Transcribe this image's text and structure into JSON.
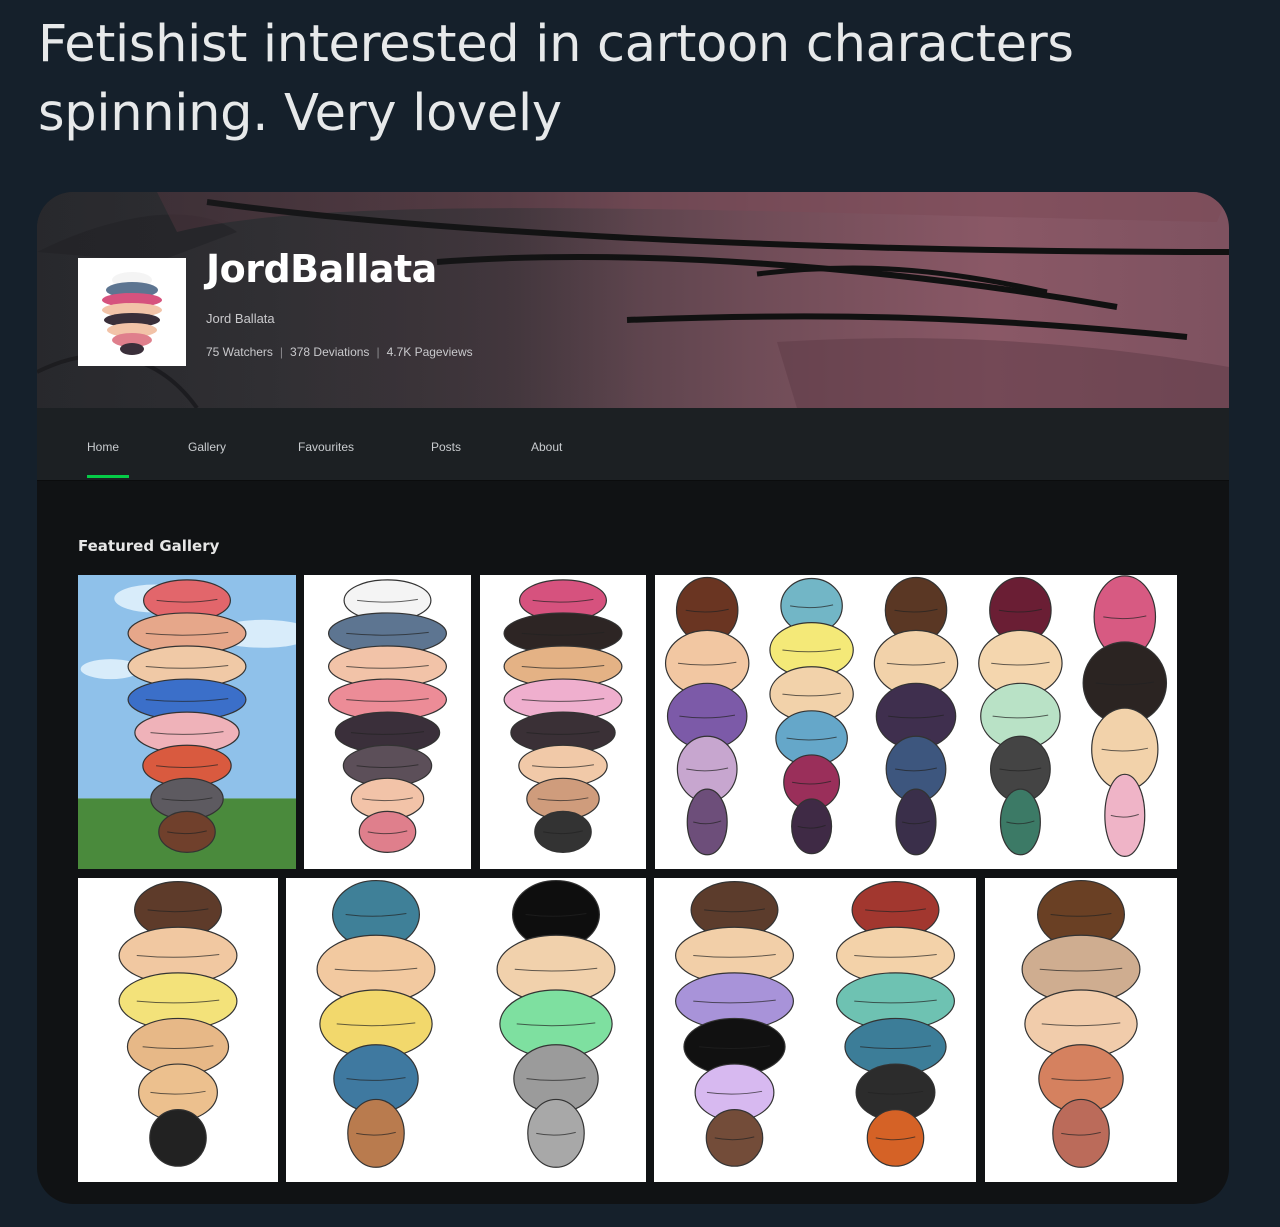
{
  "tweet": {
    "text": "Fetishist interested in cartoon characters spinning. Very lovely"
  },
  "profile": {
    "username": "JordBallata",
    "display_name": "Jord Ballata",
    "stats": {
      "watchers": "75 Watchers",
      "deviations": "378 Deviations",
      "pageviews": "4.7K Pageviews",
      "separator": "|"
    }
  },
  "nav": {
    "items": [
      "Home",
      "Gallery",
      "Favourites",
      "Posts",
      "About"
    ],
    "active": "Home"
  },
  "featured": {
    "title": "Featured Gallery",
    "thumbnails": [
      {
        "figures": [
          [
            "#e2666b",
            "#e6a78a",
            "#f0c9a6",
            "#3b6fc9",
            "#efb2b9",
            "#d95a3f",
            "#5d5a60",
            "#70402c"
          ]
        ],
        "background": "sky"
      },
      {
        "figures": [
          [
            "#f4f4f4",
            "#5d7591",
            "#f2c3a8",
            "#ec8c97",
            "#3a2f3a",
            "#5c4f59",
            "#f2c3a8",
            "#df7f8c"
          ]
        ]
      },
      {
        "figures": [
          [
            "#d6527e",
            "#2d2524",
            "#e4b285",
            "#efafce",
            "#3a3036",
            "#f1c9a8",
            "#cf9c7c",
            "#333333"
          ]
        ]
      },
      {
        "figures": [
          [
            "#6a3522",
            "#f2c7a2",
            "#7c5aa8",
            "#c7a6cf",
            "#6d4e7a"
          ],
          [
            "#72b6c6",
            "#f4e978",
            "#f2d2aa",
            "#65a7c9",
            "#9a2f5a",
            "#3f2a45"
          ],
          [
            "#5a3724",
            "#f2d2aa",
            "#3f2f4e",
            "#3d567e",
            "#3a2f4a"
          ],
          [
            "#6a1e34",
            "#f4d6ae",
            "#b9e2c6",
            "#444444",
            "#3c7a66"
          ],
          [
            "#d75a82",
            "#2b2422",
            "#f2d2aa",
            "#efb4c7"
          ]
        ]
      },
      {
        "figures": [
          [
            "#5e3b2a",
            "#f1c8a1",
            "#f3e27a",
            "#e7b887",
            "#ecc08e",
            "#222222"
          ]
        ]
      },
      {
        "figures": [
          [
            "#3f8098",
            "#f2c9a0",
            "#f2d86c",
            "#3f79a0",
            "#b97b4e"
          ],
          [
            "#0e0e0e",
            "#f1d1ac",
            "#7ee0a0",
            "#9b9b9b",
            "#a8a8a8"
          ]
        ]
      },
      {
        "figures": [
          [
            "#5c3c2c",
            "#f2cfa8",
            "#a893d9",
            "#111111",
            "#d7b9f0",
            "#734c39"
          ],
          [
            "#a2372f",
            "#f3d2a9",
            "#6ec2b2",
            "#3c7d98",
            "#2c2c2c",
            "#d56226"
          ]
        ]
      },
      {
        "figures": [
          [
            "#6a4024",
            "#cfad90",
            "#f1ccab",
            "#d5815f",
            "#bb6b5a"
          ]
        ]
      }
    ]
  }
}
